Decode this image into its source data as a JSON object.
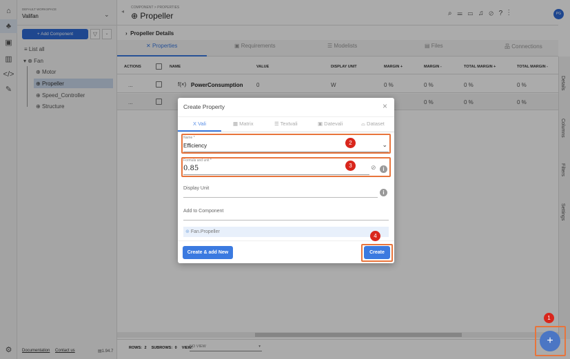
{
  "workspace": {
    "label": "DEFAULT WORKSPACE",
    "name": "Valifan"
  },
  "sidebar": {
    "add_component": "+ Add Component",
    "list_all": "List all",
    "tree": [
      {
        "label": "Fan"
      },
      {
        "label": "Motor"
      },
      {
        "label": "Propeller"
      },
      {
        "label": "Speed_Controller"
      },
      {
        "label": "Structure"
      }
    ],
    "footer": {
      "documentation": "Documentation",
      "contact": "Contact us",
      "version": "1.94.7"
    }
  },
  "header": {
    "breadcrumb": "COMPONENT > PROPERTIES",
    "title": "Propeller",
    "avatar": "PG"
  },
  "details": {
    "title": "Propeller Details"
  },
  "tabs": [
    {
      "label": "Properties"
    },
    {
      "label": "Requirements"
    },
    {
      "label": "Modelists"
    },
    {
      "label": "Files"
    },
    {
      "label": "Connections"
    }
  ],
  "table": {
    "headers": [
      "ACTIONS",
      "NAME",
      "VALUE",
      "DISPLAY UNIT",
      "MARGIN +",
      "MARGIN -",
      "TOTAL MARGIN +",
      "TOTAL MARGIN -"
    ],
    "rows": [
      {
        "actions": "...",
        "name": "PowerConsumption",
        "value": "0",
        "unit": "W",
        "m_plus": "0 %",
        "m_minus": "0 %",
        "t_plus": "0 %",
        "t_minus": "0 %"
      },
      {
        "actions": "...",
        "name": "",
        "value": "",
        "unit": "",
        "m_plus": "",
        "m_minus": "0 %",
        "t_plus": "0 %",
        "t_minus": "0 %"
      }
    ]
  },
  "footer_bar": {
    "rows": "ROWS: 2",
    "subrows": "SUBROWS: 0",
    "view_label": "VIEW:",
    "view_value": "NO VIEW"
  },
  "right_panel": [
    "Details",
    "Columns",
    "Filters",
    "Settings"
  ],
  "modal": {
    "title": "Create Property",
    "tabs": [
      "Vali",
      "Matrix",
      "Textvali",
      "Datevali",
      "Dataset"
    ],
    "name_label": "Name *",
    "name_value": "Efficiency",
    "formula_label": "Formula and unit *",
    "formula_value": "0.85",
    "display_unit_placeholder": "Display Unit",
    "add_to_component_placeholder": "Add to Component",
    "component_chip": "Fan.Propeller",
    "create_add_new": "Create & add New",
    "create": "Create"
  },
  "steps": [
    "1",
    "2",
    "3",
    "4"
  ],
  "colors": {
    "primary": "#3b7ae0",
    "highlight": "#e8743b",
    "badge": "#d9261c"
  }
}
